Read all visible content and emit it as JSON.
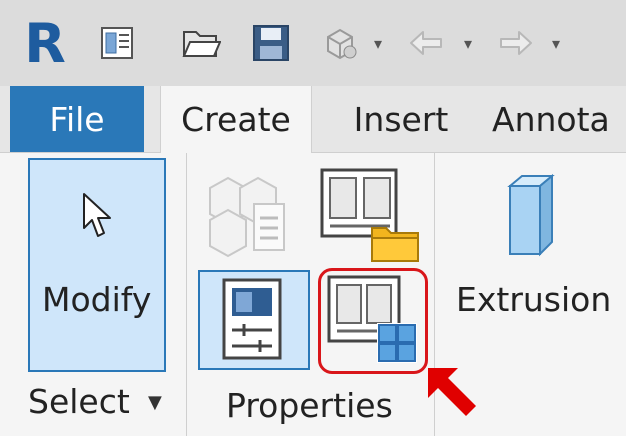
{
  "qat": {
    "logo_letter": "R",
    "icons": [
      "properties-icon",
      "open-folder-icon",
      "save-icon",
      "sync-icon",
      "undo-icon",
      "redo-icon"
    ]
  },
  "tabs": [
    {
      "label": "File"
    },
    {
      "label": "Create"
    },
    {
      "label": "Insert"
    },
    {
      "label": "Annota"
    }
  ],
  "select_panel": {
    "modify_label": "Modify",
    "group_label": "Select",
    "dropdown_glyph": "▼"
  },
  "properties_panel": {
    "group_label": "Properties"
  },
  "build_panel": {
    "extrusion_label": "Extrusion"
  },
  "colors": {
    "accent": "#2a78b8",
    "highlight": "#d9161a",
    "folder": "#f2b51e",
    "arrow": "#e00000"
  }
}
